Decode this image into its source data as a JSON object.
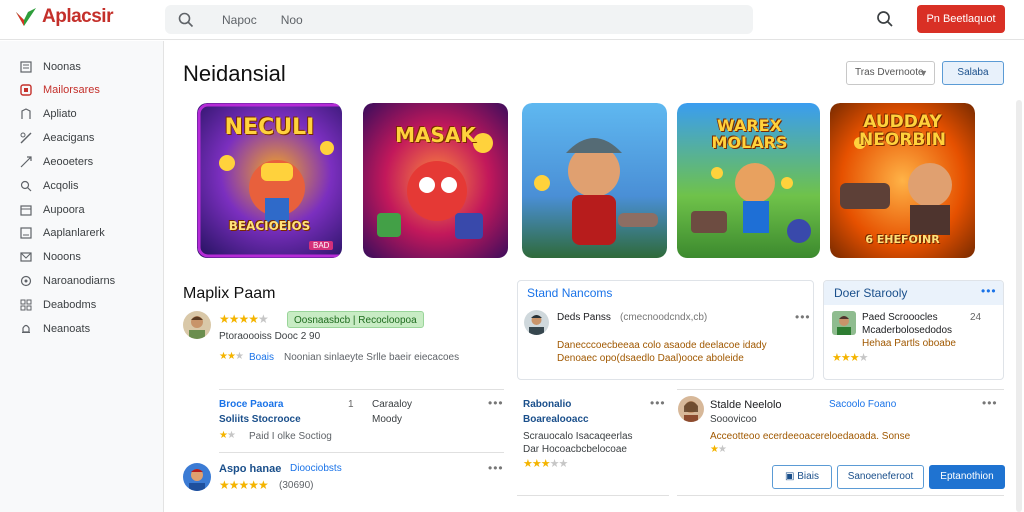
{
  "app": {
    "name": "Aplacsir"
  },
  "search": {
    "placeholder_a": "Napoc",
    "placeholder_b": "Noo"
  },
  "header": {
    "cta_label": "Pn Beetlaquot"
  },
  "sidebar": {
    "items": [
      {
        "label": "Noonas",
        "icon": "home-icon"
      },
      {
        "label": "Mailorsares",
        "icon": "store-icon",
        "active": true
      },
      {
        "label": "Apliato",
        "icon": "apps-icon"
      },
      {
        "label": "Aeacigans",
        "icon": "games-icon"
      },
      {
        "label": "Aeooeters",
        "icon": "tag-icon"
      },
      {
        "label": "Acqolis",
        "icon": "search-icon"
      },
      {
        "label": "Aupoora",
        "icon": "calendar-icon"
      },
      {
        "label": "Aaplanlarerk",
        "icon": "bookmark-icon"
      },
      {
        "label": "Nooons",
        "icon": "mail-icon"
      },
      {
        "label": "Naroanodiarns",
        "icon": "settings-icon"
      },
      {
        "label": "Deabodms",
        "icon": "grid-icon"
      },
      {
        "label": "Neanoats",
        "icon": "bell-icon"
      }
    ]
  },
  "main": {
    "title": "Neidansial",
    "filter_value": "Tras Dvernoote",
    "apply_label": "Salaba"
  },
  "games": [
    {
      "title": "NECULI",
      "subtitle": "BEACIOEIOS",
      "badge": "BAD"
    },
    {
      "title": "MASAK",
      "subtitle": "",
      "badge": ""
    },
    {
      "title": "",
      "subtitle": "",
      "badge": ""
    },
    {
      "title": "WAREX MOLARS",
      "subtitle": "",
      "badge": ""
    },
    {
      "title": "AUDDAY NEORBIN",
      "subtitle": "6 EHEFOINR",
      "badge": ""
    }
  ],
  "reviews": {
    "section_title": "Maplix Paam",
    "r1": {
      "rating": 4,
      "pill": "Oosnaasbcb | Recocloopoa",
      "sub": "Ptoraoooiss Dooc 2 90",
      "line": "Noonian sinlaeyte Srlle baeir eiecacoes",
      "line_tag": "Boais",
      "sub_rating": 2
    },
    "r2": {
      "name": "Broce Paoara",
      "sub": "Soliits Stocrooce",
      "id": "1",
      "col2a": "Caraaloy",
      "col2b": "Moody",
      "line": "Paid I olke Soctiog",
      "rating": 2
    },
    "r3": {
      "name": "Aspo hanae",
      "tag": "Dioociobsts",
      "count": "(30690)",
      "rating": 5
    },
    "p1": {
      "head": "Stand Nancoms",
      "name": "Deds Panss",
      "meta": "(cmecnoodcndx,cb)",
      "text1": "Danecccoecbeeaa colo asaode deelacoe idady",
      "text2": "Denoaec opo(dsaedlo Daal)ooce aboleide"
    },
    "p2": {
      "name": "Rabonalio",
      "sub": "Boarealooacc",
      "text1": "Scrauocalo Isacaqeerlas",
      "text2": "Dar Hocoacbcbelocoae",
      "rating": 3
    },
    "p3": {
      "head": "Doer Starooly",
      "name": "Paed Scrooocles",
      "id": "24",
      "text1": "Mcaderbolosedodos",
      "text2": "Hehaa Partls oboabe",
      "rating": 3
    },
    "p4": {
      "name": "Stalde Neelolo",
      "tag": "Sacoolo Foano",
      "sub": "Sooovicoo",
      "text": "Acceotteoo ecerdeeoacereloedaoada. Sonse",
      "rating": 2
    },
    "buttons": {
      "b1": "Biais",
      "b2": "Sanoeneferoot",
      "b3": "Eptanothion"
    }
  }
}
